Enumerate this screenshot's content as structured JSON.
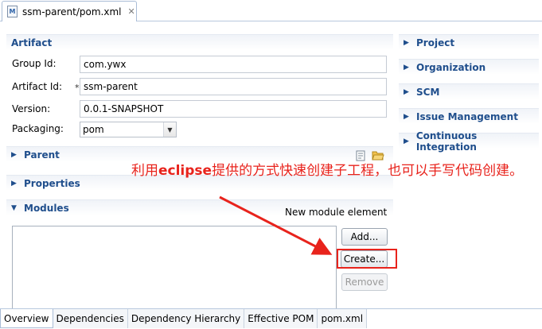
{
  "editor_tab": {
    "title": "ssm-parent/pom.xml",
    "icon": "maven-pom-file-icon"
  },
  "artifact": {
    "title": "Artifact",
    "group_id_label": "Group Id:",
    "group_id_value": "com.ywx",
    "artifact_id_label": "Artifact Id:",
    "required_mark": "*",
    "artifact_id_value": "ssm-parent",
    "version_label": "Version:",
    "version_value": "0.0.1-SNAPSHOT",
    "packaging_label": "Packaging:",
    "packaging_value": "pom"
  },
  "left_sections": {
    "parent": "Parent",
    "properties": "Properties",
    "modules": "Modules"
  },
  "right_sections": [
    "Project",
    "Organization",
    "SCM",
    "Issue Management",
    "Continuous Integration"
  ],
  "modules": {
    "new_element_label": "New module element",
    "add_button": "Add...",
    "create_button": "Create...",
    "remove_button": "Remove"
  },
  "annotation": {
    "before": "利用",
    "keyword": "eclipse",
    "after": "提供的方式快速创建子工程，也可以手写代码创建。"
  },
  "page_tabs": [
    "Overview",
    "Dependencies",
    "Dependency Hierarchy",
    "Effective POM",
    "pom.xml"
  ],
  "colors": {
    "section_title": "#1f4e8c",
    "annotation_red": "#e8231c"
  }
}
